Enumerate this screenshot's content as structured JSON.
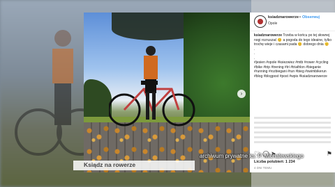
{
  "instagram": {
    "username": "ksiadznarowerze",
    "dot": "•",
    "follow_label": "Obserwuj",
    "location": "Opole",
    "caption_user": "ksiadznarowerze",
    "caption_text": " Trzeba w końcu po tej słownej nogi rozruszać 😊 a pogoda do tego ideaine, tylko trochę wieje i czasami pada 😊 dobrego dnia 😊",
    "caption_dots": ".\n.\n.",
    "hashtags": "#jesien #opole #ksiezwiez #mtb #rower #cycling #bike #trip #trening #tri #triathlon #bieganie #running #rozbiegani #run #bieg #swimbikerun #blog #blogpost #post #wpis #ksiadznarowerze",
    "likes_text": "Liczba polubień: 1 234",
    "time_text": "4 DNI TEMU",
    "heart_icon": "heart-icon",
    "comment_icon": "comment-icon",
    "share_icon": "share-icon",
    "bookmark_icon": "bookmark-icon"
  },
  "overlay": {
    "caption": "Ksiądz na rowerze",
    "credit": "archiwum prywatne ks. P. Michalewskiego"
  },
  "colors": {
    "follow_blue": "#3897f0",
    "caption_bar": "#ffffff"
  }
}
